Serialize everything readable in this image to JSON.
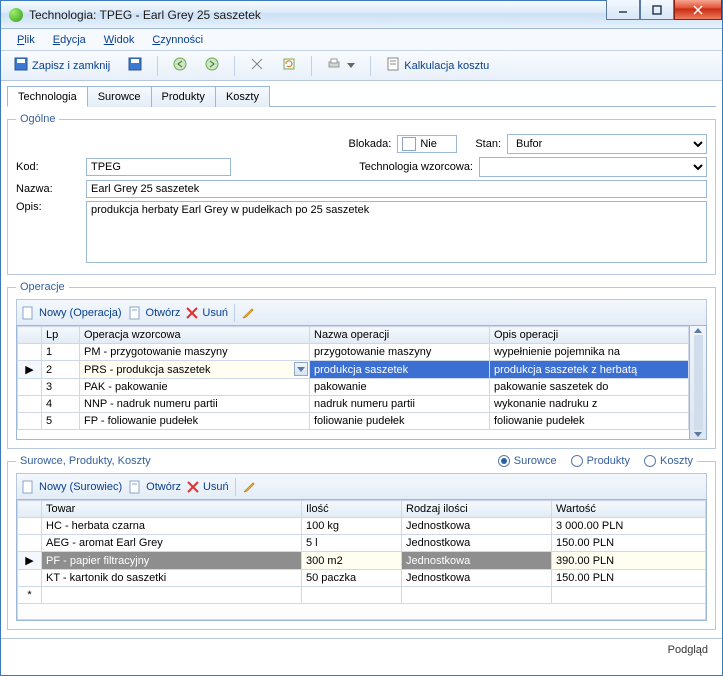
{
  "window": {
    "title": "Technologia: TPEG - Earl Grey 25 saszetek"
  },
  "menu": {
    "plik": "Plik",
    "edycja": "Edycja",
    "widok": "Widok",
    "czynnosci": "Czynności"
  },
  "toolbar": {
    "zapisz": "Zapisz i zamknij",
    "kalk": "Kalkulacja kosztu"
  },
  "tabs": {
    "tech": "Technologia",
    "sur": "Surowce",
    "prod": "Produkty",
    "kosz": "Koszty"
  },
  "general": {
    "legend": "Ogólne",
    "blokada_lbl": "Blokada:",
    "blokada_val": "Nie",
    "stan_lbl": "Stan:",
    "stan_val": "Bufor",
    "kod_lbl": "Kod:",
    "kod_val": "TPEG",
    "techw_lbl": "Technologia wzorcowa:",
    "techw_val": "",
    "nazwa_lbl": "Nazwa:",
    "nazwa_val": "Earl Grey 25 saszetek",
    "opis_lbl": "Opis:",
    "opis_val": "produkcja herbaty Earl Grey w pudełkach po 25 saszetek"
  },
  "ops": {
    "legend": "Operacje",
    "nowy": "Nowy (Operacja)",
    "otworz": "Otwórz",
    "usun": "Usuń",
    "cols": {
      "lp": "Lp",
      "wz": "Operacja wzorcowa",
      "nazwa": "Nazwa operacji",
      "opis": "Opis operacji"
    },
    "rows": [
      {
        "lp": "1",
        "wz": "PM - przygotowanie maszyny",
        "nazwa": "przygotowanie maszyny",
        "opis": "wypełnienie pojemnika na"
      },
      {
        "lp": "2",
        "wz": "PRS - produkcja saszetek",
        "nazwa": "produkcja saszetek",
        "opis": "produkcja saszetek z herbatą"
      },
      {
        "lp": "3",
        "wz": "PAK - pakowanie",
        "nazwa": "pakowanie",
        "opis": "pakowanie saszetek do"
      },
      {
        "lp": "4",
        "wz": "NNP - nadruk numeru partii",
        "nazwa": "nadruk numeru partii",
        "opis": "wykonanie nadruku z"
      },
      {
        "lp": "5",
        "wz": "FP - foliowanie pudełek",
        "nazwa": "foliowanie pudełek",
        "opis": "foliowanie pudełek"
      }
    ]
  },
  "spk": {
    "legend": "Surowce, Produkty, Koszty",
    "r_sur": "Surowce",
    "r_pro": "Produkty",
    "r_kos": "Koszty",
    "nowy": "Nowy (Surowiec)",
    "otworz": "Otwórz",
    "usun": "Usuń",
    "cols": {
      "towar": "Towar",
      "ilosc": "Ilość",
      "rodzaj": "Rodzaj ilości",
      "wartosc": "Wartość"
    },
    "rows": [
      {
        "towar": "HC - herbata czarna",
        "ilosc": "100 kg",
        "rodzaj": "Jednostkowa",
        "wartosc": "3 000.00 PLN"
      },
      {
        "towar": "AEG - aromat Earl Grey",
        "ilosc": "5 l",
        "rodzaj": "Jednostkowa",
        "wartosc": "150.00 PLN"
      },
      {
        "towar": "PF - papier filtracyjny",
        "ilosc": "300 m2",
        "rodzaj": "Jednostkowa",
        "wartosc": "390.00 PLN"
      },
      {
        "towar": "KT - kartonik do saszetki",
        "ilosc": "50 paczka",
        "rodzaj": "Jednostkowa",
        "wartosc": "150.00 PLN"
      }
    ],
    "star": "*"
  },
  "status": {
    "podglad": "Podgląd"
  }
}
